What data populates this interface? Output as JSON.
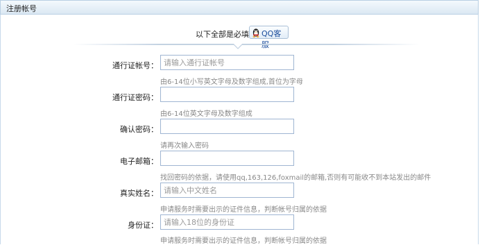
{
  "header": {
    "title": "注册帐号"
  },
  "notice": {
    "text": "以下全部是必填项",
    "qq_button_label": "QQ客服"
  },
  "form": {
    "fields": [
      {
        "label": "通行证帐号：",
        "value": "",
        "placeholder": "请输入通行证帐号",
        "hint": "由6-14位小写英文字母及数字组成,首位为字母"
      },
      {
        "label": "通行证密码：",
        "value": "",
        "placeholder": "",
        "hint": "由6-14位英文字母及数字组成"
      },
      {
        "label": "确认密码：",
        "value": "",
        "placeholder": "",
        "hint": "请再次输入密码"
      },
      {
        "label": "电子邮箱：",
        "value": "",
        "placeholder": "",
        "hint": "找回密码的依据，请使用qq,163,126,foxmail的邮箱,否则有可能收不到本站发出的邮件"
      },
      {
        "label": "真实姓名：",
        "value": "",
        "placeholder": "请输入中文姓名",
        "hint": "申请服务时需要出示的证件信息，判断帐号归属的依据"
      },
      {
        "label": "身份证：",
        "value": "",
        "placeholder": "请输入18位的身份证",
        "hint": "申请服务时需要出示的证件信息，判断帐号归属的依据"
      }
    ]
  },
  "colors": {
    "input_border": "#9fb5d2",
    "hint_text": "#888888",
    "title_bar": "#dbe8f3"
  },
  "icons": {
    "qq": "qq-penguin-icon"
  }
}
